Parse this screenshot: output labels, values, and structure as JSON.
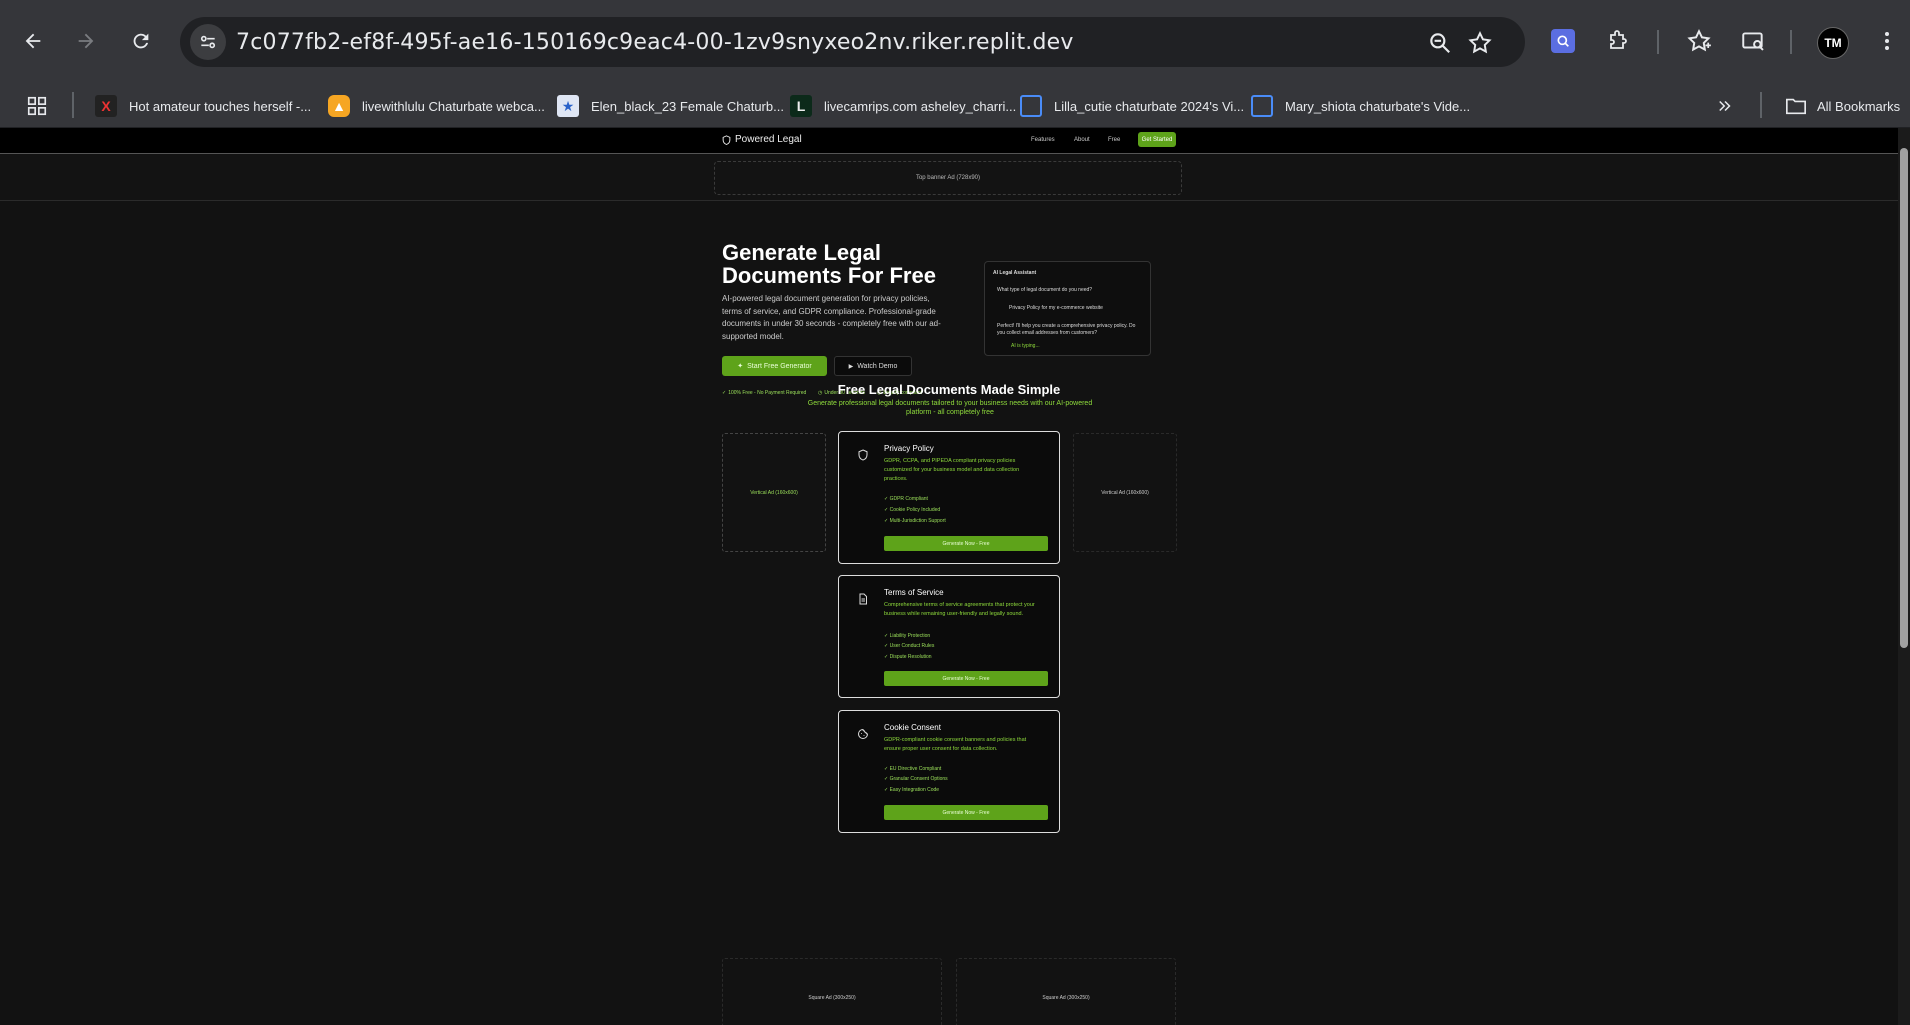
{
  "browser": {
    "url": "7c077fb2-ef8f-495f-ae16-150169c9eac4-00-1zv9snyxeo2nv.riker.replit.dev",
    "bookmarks": [
      {
        "label": "Hot amateur touches herself -...",
        "icon": "x-icon"
      },
      {
        "label": "livewithlulu Chaturbate webca...",
        "icon": "warning-triangle-icon"
      },
      {
        "label": "Elen_black_23 Female Chaturb...",
        "icon": "star-badge-icon"
      },
      {
        "label": "livecamrips.com asheley_charri...",
        "icon": "l-letter-icon"
      },
      {
        "label": "Lilla_cutie chaturbate 2024's Vi...",
        "icon": "square-outline-icon"
      },
      {
        "label": "Mary_shiota chaturbate's Vide...",
        "icon": "square-outline-icon"
      }
    ],
    "all_bookmarks_label": "All Bookmarks",
    "avatar_text": "TM"
  },
  "site": {
    "brand": "Powered Legal",
    "nav": [
      "Features",
      "About",
      "Free"
    ],
    "cta": "Get Started",
    "ad_top_label": "Top banner Ad (728x90)",
    "hero": {
      "title_line1": "Generate Legal",
      "title_line2": "Documents For Free",
      "description": "AI-powered legal document generation for privacy policies, terms of service, and GDPR compliance. Professional-grade documents in under 30 seconds - completely free with our ad-supported model.",
      "primary_btn": "Start Free Generator",
      "secondary_btn": "Watch Demo",
      "features": [
        "100% Free - No Payment Required",
        "Under 30 seconds",
        "Legally compliant"
      ]
    },
    "assistant": {
      "title": "AI Legal Assistant",
      "question": "What type of legal document do you need?",
      "user_reply": "Privacy Policy for my e-commerce website",
      "answer": "Perfect! I'll help you create a comprehensive privacy policy. Do you collect email addresses from customers?",
      "status": "AI is typing..."
    },
    "section": {
      "title": "Free Legal Documents Made Simple",
      "subtitle": "Generate professional legal documents tailored to your business needs with our AI-powered platform - all completely free"
    },
    "side_ad_left": "Vertical Ad (160x600)",
    "side_ad_right": "Vertical Ad (160x600)",
    "bottom_ads": [
      "Square Ad (300x250)",
      "Square Ad (300x250)"
    ],
    "cards": [
      {
        "title": "Privacy Policy",
        "description": "GDPR, CCPA, and PIPEDA compliant privacy policies customized for your business model and data collection practices.",
        "features": [
          "GDPR Compliant",
          "Cookie Policy Included",
          "Multi-Jurisdiction Support"
        ],
        "button": "Generate Now - Free",
        "icon": "shield-icon"
      },
      {
        "title": "Terms of Service",
        "description": "Comprehensive terms of service agreements that protect your business while remaining user-friendly and legally sound.",
        "features": [
          "Liability Protection",
          "User Conduct Rules",
          "Dispute Resolution"
        ],
        "button": "Generate Now - Free",
        "icon": "document-icon"
      },
      {
        "title": "Cookie Consent",
        "description": "GDPR-compliant cookie consent banners and policies that ensure proper user consent for data collection.",
        "features": [
          "EU Directive Compliant",
          "Granular Consent Options",
          "Easy Integration Code"
        ],
        "button": "Generate Now - Free",
        "icon": "cookie-icon"
      }
    ]
  },
  "colors": {
    "accent": "#5ea31a",
    "accent_text": "#8fdc3c",
    "page_bg": "#121212"
  }
}
